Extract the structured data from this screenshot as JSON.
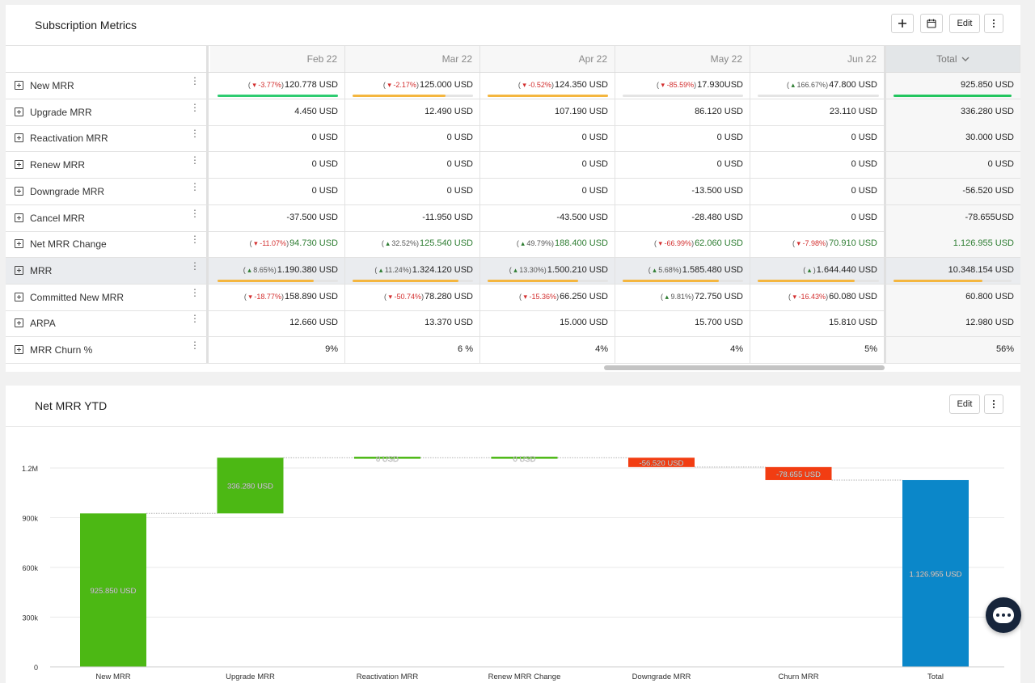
{
  "metrics_card": {
    "title": "Subscription Metrics",
    "toolbar": {
      "add_icon": "plus-icon",
      "calendar_icon": "calendar-icon",
      "edit_label": "Edit",
      "more_icon": "kebab-icon"
    },
    "columns": [
      "Feb 22",
      "Mar 22",
      "Apr 22",
      "May 22",
      "Jun 22"
    ],
    "total_label": "Total",
    "rows": [
      {
        "label": "New MRR",
        "highlight": false,
        "total": "925.850 USD",
        "total_bar": {
          "fill": 1.0,
          "color": "#22c55e"
        },
        "cells": [
          {
            "change": "-3.77%",
            "dir": "down",
            "value": "120.778 USD",
            "bar": {
              "fill": 1.0,
              "color": "#2ecc71"
            }
          },
          {
            "change": "-2.17%",
            "dir": "down",
            "value": "125.000 USD",
            "bar": {
              "fill": 0.77,
              "color": "#f4b63f"
            }
          },
          {
            "change": "-0.52%",
            "dir": "down",
            "value": "124.350 USD",
            "bar": {
              "fill": 1.0,
              "color": "#f4b63f"
            }
          },
          {
            "change": "-85.59%",
            "dir": "down",
            "value": "17.930USD",
            "bar": {
              "fill": 0.0,
              "color": "#f4b63f"
            }
          },
          {
            "change": "166.67%",
            "dir": "up",
            "value": "47.800 USD",
            "bar": {
              "fill": 0.0,
              "color": "#f4b63f"
            }
          }
        ]
      },
      {
        "label": "Upgrade MRR",
        "total": "336.280 USD",
        "cells": [
          {
            "value": "4.450 USD"
          },
          {
            "value": "12.490 USD"
          },
          {
            "value": "107.190 USD"
          },
          {
            "value": "86.120 USD"
          },
          {
            "value": "23.110 USD"
          }
        ]
      },
      {
        "label": "Reactivation MRR",
        "total": "30.000 USD",
        "cells": [
          {
            "value": "0 USD"
          },
          {
            "value": "0 USD"
          },
          {
            "value": "0 USD"
          },
          {
            "value": "0 USD"
          },
          {
            "value": "0 USD"
          }
        ]
      },
      {
        "label": "Renew MRR",
        "total": "0 USD",
        "cells": [
          {
            "value": "0 USD"
          },
          {
            "value": "0 USD"
          },
          {
            "value": "0 USD"
          },
          {
            "value": "0 USD"
          },
          {
            "value": "0 USD"
          }
        ]
      },
      {
        "label": "Downgrade MRR",
        "total": "-56.520 USD",
        "cells": [
          {
            "value": "0 USD"
          },
          {
            "value": "0 USD"
          },
          {
            "value": "0 USD"
          },
          {
            "value": "-13.500 USD"
          },
          {
            "value": "0 USD"
          }
        ]
      },
      {
        "label": "Cancel MRR",
        "total": "-78.655USD",
        "cells": [
          {
            "value": "-37.500 USD"
          },
          {
            "value": "-11.950 USD"
          },
          {
            "value": "-43.500 USD"
          },
          {
            "value": "-28.480 USD"
          },
          {
            "value": "0 USD"
          }
        ]
      },
      {
        "label": "Net MRR Change",
        "total": "1.126.955 USD",
        "green": true,
        "cells": [
          {
            "change": "-11.07%",
            "dir": "down",
            "value": "94.730 USD"
          },
          {
            "change": "32.52%",
            "dir": "up",
            "value": "125.540 USD"
          },
          {
            "change": "49.79%",
            "dir": "up",
            "value": "188.400 USD"
          },
          {
            "change": "-66.99%",
            "dir": "down",
            "value": "62.060 USD"
          },
          {
            "change": "-7.98%",
            "dir": "down",
            "value": "70.910 USD"
          }
        ]
      },
      {
        "label": "MRR",
        "highlight": true,
        "total": "10.348.154 USD",
        "total_bar": {
          "fill": 0.75,
          "color": "#f4b63f"
        },
        "cells": [
          {
            "change": "8.65%",
            "dir": "up",
            "value": "1.190.380 USD",
            "bar": {
              "fill": 0.8,
              "color": "#f4b63f"
            }
          },
          {
            "change": "11.24%",
            "dir": "up",
            "value": "1.324.120 USD",
            "bar": {
              "fill": 0.88,
              "color": "#f4b63f"
            }
          },
          {
            "change": "13.30%",
            "dir": "up",
            "value": "1.500.210 USD",
            "bar": {
              "fill": 0.75,
              "color": "#f4b63f"
            }
          },
          {
            "change": "5.68%",
            "dir": "up",
            "value": "1.585.480 USD",
            "bar": {
              "fill": 0.8,
              "color": "#f4b63f"
            }
          },
          {
            "change": "",
            "dir": "up",
            "value": "1.644.440 USD",
            "bar": {
              "fill": 0.8,
              "color": "#f4b63f"
            }
          }
        ]
      },
      {
        "label": "Committed New MRR",
        "total": "60.800 USD",
        "cells": [
          {
            "change": "-18.77%",
            "dir": "down",
            "value": "158.890 USD"
          },
          {
            "change": "-50.74%",
            "dir": "down",
            "value": "78.280 USD"
          },
          {
            "change": "-15.36%",
            "dir": "down",
            "value": "66.250 USD"
          },
          {
            "change": "9.81%",
            "dir": "up",
            "value": "72.750 USD"
          },
          {
            "change": "-16.43%",
            "dir": "down",
            "value": "60.080 USD"
          }
        ]
      },
      {
        "label": "ARPA",
        "total": "12.980 USD",
        "cells": [
          {
            "value": "12.660 USD"
          },
          {
            "value": "13.370 USD"
          },
          {
            "value": "15.000 USD"
          },
          {
            "value": "15.700 USD"
          },
          {
            "value": "15.810 USD"
          }
        ]
      },
      {
        "label": "MRR Churn %",
        "total": "56%",
        "cells": [
          {
            "value": "9%"
          },
          {
            "value": "6 %"
          },
          {
            "value": "4%"
          },
          {
            "value": "4%"
          },
          {
            "value": "5%"
          }
        ]
      }
    ]
  },
  "chart_card": {
    "title": "Net MRR YTD",
    "toolbar": {
      "edit_label": "Edit",
      "more_icon": "kebab-icon"
    }
  },
  "chart_data": {
    "type": "bar",
    "subtype": "waterfall",
    "title": "Net MRR YTD",
    "categories": [
      "New MRR",
      "Upgrade MRR",
      "Reactivation MRR",
      "Renew MRR Change",
      "Downgrade MRR",
      "Churn MRR",
      "Total"
    ],
    "values": [
      925850,
      336280,
      0,
      0,
      -56520,
      -78655,
      1126955
    ],
    "labels": [
      "925.850 USD",
      "336.280 USD",
      "0 USD",
      "0 USD",
      "-56.520 USD",
      "-78.655 USD",
      "1.126.955 USD"
    ],
    "colors": {
      "increase": "#4cb814",
      "decrease": "#f23d12",
      "total": "#0b87c9"
    },
    "y_ticks": [
      {
        "v": 0,
        "label": "0"
      },
      {
        "v": 300000,
        "label": "300k"
      },
      {
        "v": 600000,
        "label": "600k"
      },
      {
        "v": 900000,
        "label": "900k"
      },
      {
        "v": 1200000,
        "label": "1.2M"
      }
    ],
    "ylim": [
      0,
      1400000
    ],
    "grid": true,
    "xlabel": "",
    "ylabel": ""
  },
  "chat_widget": {
    "icon": "chat-icon"
  }
}
